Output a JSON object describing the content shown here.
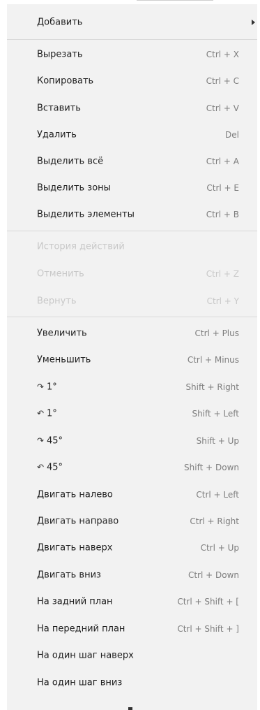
{
  "menu": {
    "add": {
      "label": "Добавить",
      "has_submenu": true
    },
    "edit": [
      {
        "label": "Вырезать",
        "shortcut": "Ctrl + X"
      },
      {
        "label": "Копировать",
        "shortcut": "Ctrl + C"
      },
      {
        "label": "Вставить",
        "shortcut": "Ctrl + V"
      },
      {
        "label": "Удалить",
        "shortcut": "Del"
      },
      {
        "label": "Выделить всё",
        "shortcut": "Ctrl + A"
      },
      {
        "label": "Выделить зоны",
        "shortcut": "Ctrl + E"
      },
      {
        "label": "Выделить элементы",
        "shortcut": "Ctrl + B"
      }
    ],
    "history": [
      {
        "label": "История действий",
        "shortcut": "",
        "disabled": true
      },
      {
        "label": "Отменить",
        "shortcut": "Ctrl + Z",
        "disabled": true
      },
      {
        "label": "Вернуть",
        "shortcut": "Ctrl + Y",
        "disabled": true
      }
    ],
    "view": [
      {
        "label": "Увеличить",
        "shortcut": "Ctrl + Plus"
      },
      {
        "label": "Уменьшить",
        "shortcut": "Ctrl + Minus"
      },
      {
        "icon": "rotate-clockwise-icon",
        "glyph": "↷",
        "label": "1°",
        "shortcut": "Shift + Right"
      },
      {
        "icon": "rotate-counterclockwise-icon",
        "glyph": "↶",
        "label": "1°",
        "shortcut": "Shift + Left"
      },
      {
        "icon": "rotate-clockwise-icon",
        "glyph": "↷",
        "label": "45°",
        "shortcut": "Shift + Up"
      },
      {
        "icon": "rotate-counterclockwise-icon",
        "glyph": "↶",
        "label": "45°",
        "shortcut": "Shift + Down"
      },
      {
        "label": "Двигать налево",
        "shortcut": "Ctrl + Left"
      },
      {
        "label": "Двигать направо",
        "shortcut": "Ctrl + Right"
      },
      {
        "label": "Двигать наверх",
        "shortcut": "Ctrl + Up"
      },
      {
        "label": "Двигать вниз",
        "shortcut": "Ctrl + Down"
      },
      {
        "label": "На задний план",
        "shortcut": "Ctrl + Shift + ["
      },
      {
        "label": "На передний план",
        "shortcut": "Ctrl + Shift + ]"
      },
      {
        "label": "На один шаг наверх",
        "shortcut": ""
      },
      {
        "label": "На один шаг вниз",
        "shortcut": ""
      }
    ]
  },
  "colors": {
    "menu_background": "#f2f2f2",
    "text": "#1e1e1e",
    "shortcut_text": "#7d7d7d",
    "disabled_text": "#c8c8c8",
    "separator": "#d9d9d9"
  }
}
